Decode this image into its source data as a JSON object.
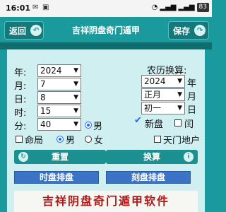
{
  "status": {
    "time": "16:01",
    "battery": "83"
  },
  "header": {
    "title": "吉祥阴盘奇门遁甲",
    "back_label": "返回",
    "save_label": "保存"
  },
  "solar": {
    "year": {
      "label": "年:",
      "value": "2024"
    },
    "month": {
      "label": "月:",
      "value": "7"
    },
    "day": {
      "label": "日:",
      "value": "8"
    },
    "hour": {
      "label": "时:",
      "value": "15"
    },
    "minute": {
      "label": "分:",
      "value": "40"
    }
  },
  "lunar": {
    "heading": "农历换算:",
    "year_value": "2024",
    "year_unit": "年",
    "month_value": "正月",
    "month_unit": "月",
    "day_value": "初一",
    "day_unit": "日"
  },
  "options": {
    "xinpan": "新盘",
    "run": "闰",
    "mingju": "命局",
    "male": "男",
    "female": "女",
    "tianmen": "天门地户"
  },
  "buttons": {
    "reset": "重置",
    "convert": "换算",
    "shipan": "时盘排盘",
    "kepan": "刻盘排盘"
  },
  "banner": "吉祥阴盘奇门遁甲软件"
}
